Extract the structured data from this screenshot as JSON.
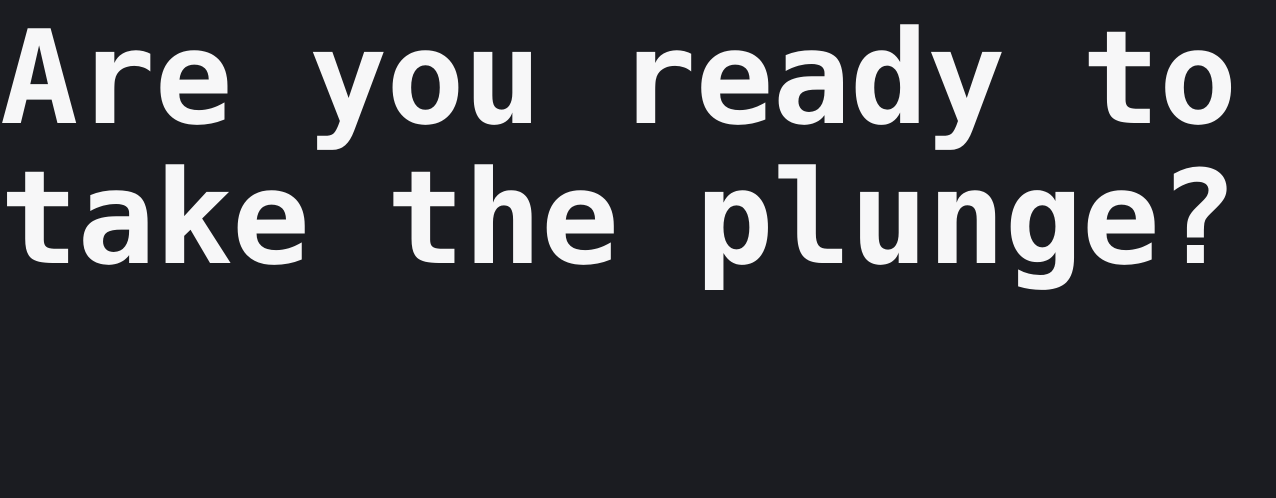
{
  "headline": {
    "line1": "Are you ready to",
    "line2": "take the plunge?"
  },
  "colors": {
    "background": "#1b1c21",
    "text": "#f7f7f8"
  }
}
